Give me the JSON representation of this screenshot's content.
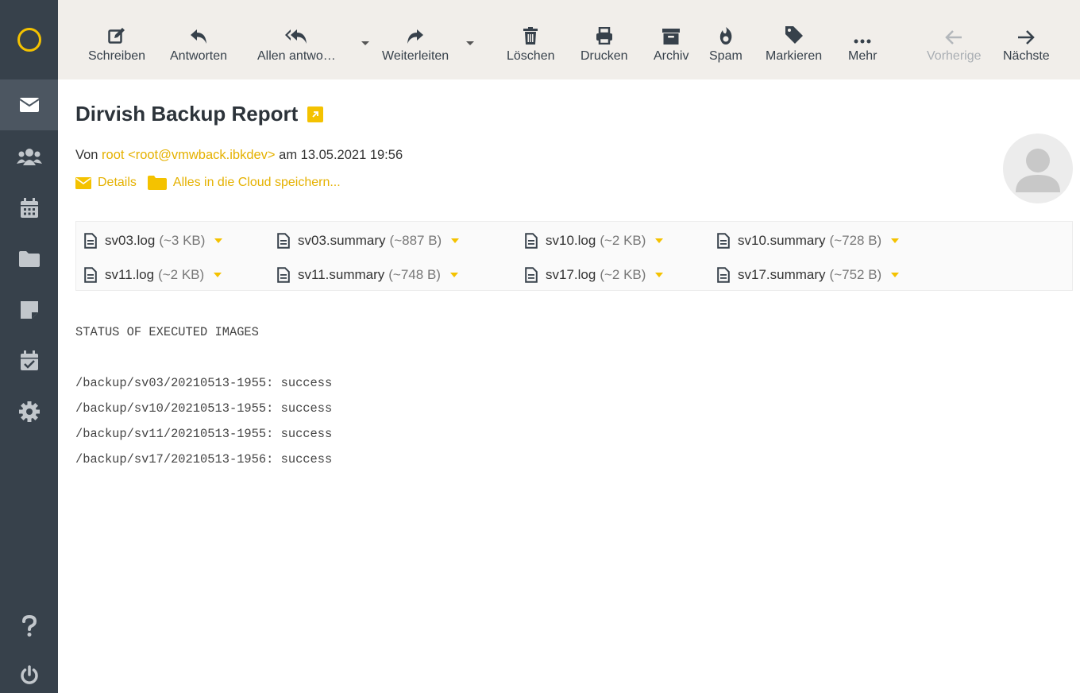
{
  "toolbar": {
    "compose": "Schreiben",
    "reply": "Antworten",
    "reply_all": "Allen antwo…",
    "forward": "Weiterleiten",
    "delete": "Löschen",
    "print": "Drucken",
    "archive": "Archiv",
    "spam": "Spam",
    "mark": "Markieren",
    "more": "Mehr",
    "previous": "Vorherige",
    "next": "Nächste"
  },
  "message": {
    "subject": "Dirvish Backup Report",
    "from_prefix": "Von",
    "sender_link": "root <root@vmwback.ibkdev>",
    "date_text": "am 13.05.2021 19:56",
    "details_label": "Details",
    "cloud_label": "Alles in die Cloud speichern..."
  },
  "attachments": [
    {
      "name": "sv03.log",
      "size": "(~3 KB)"
    },
    {
      "name": "sv03.summary",
      "size": "(~887 B)"
    },
    {
      "name": "sv10.log",
      "size": "(~2 KB)"
    },
    {
      "name": "sv10.summary",
      "size": "(~728 B)"
    },
    {
      "name": "sv11.log",
      "size": "(~2 KB)"
    },
    {
      "name": "sv11.summary",
      "size": "(~748 B)"
    },
    {
      "name": "sv17.log",
      "size": "(~2 KB)"
    },
    {
      "name": "sv17.summary",
      "size": "(~752 B)"
    }
  ],
  "body": {
    "heading": "STATUS OF EXECUTED IMAGES",
    "lines": [
      "/backup/sv03/20210513-1955: success",
      "/backup/sv10/20210513-1955: success",
      "/backup/sv11/20210513-1955: success",
      "/backup/sv17/20210513-1956: success"
    ]
  },
  "colors": {
    "accent": "#f4c200",
    "sidebar": "#37414b",
    "toolbar_bg": "#f1eeea"
  },
  "icons": {
    "sidebar": [
      "mail-icon",
      "contacts-icon",
      "calendar-icon",
      "folder-icon",
      "notes-icon",
      "tasks-icon",
      "settings-icon",
      "help-icon",
      "logout-icon"
    ],
    "toolbar": [
      "compose-icon",
      "reply-icon",
      "reply-all-icon",
      "forward-icon",
      "trash-icon",
      "print-icon",
      "archive-icon",
      "spam-icon",
      "tag-icon",
      "more-icon",
      "arrow-left-icon",
      "arrow-right-icon"
    ]
  }
}
